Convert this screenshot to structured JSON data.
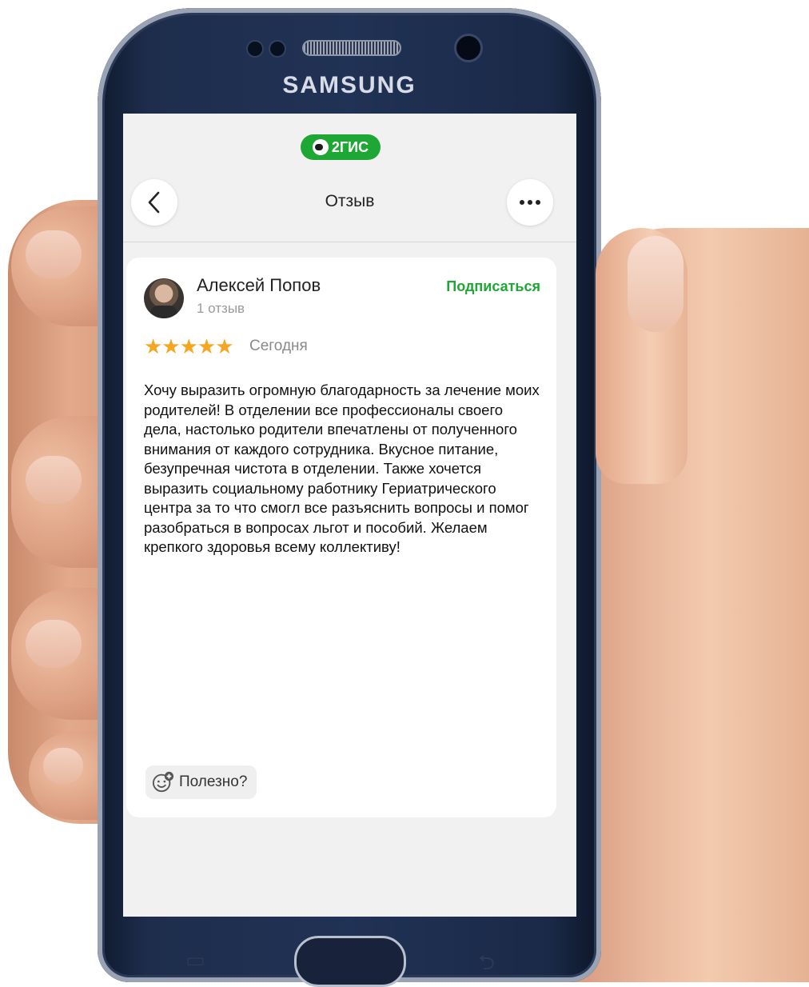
{
  "device": {
    "brand": "SAMSUNG"
  },
  "app": {
    "logo_text": "2ГИС",
    "title": "Отзыв",
    "colors": {
      "accent": "#1fa736",
      "star": "#f5a623"
    }
  },
  "review": {
    "author": "Алексей Попов",
    "author_reviews": "1 отзыв",
    "subscribe_label": "Подписаться",
    "stars": "★★★★★",
    "rating": 5,
    "date": "Сегодня",
    "text": "Хочу выразить огромную благодарность за лечение моих родителей! В отделении все профессионалы своего дела, настолько родители впечатлены от полученного внимания от каждого сотрудника. Вкусное питание, безупречная чистота в отделении. Также хочется выразить социальному работнику Гериатрического центра за то что смогл все разъяснить вопросы и помог разобраться в вопросах льгот и пособий. Желаем крепкого здоровья всему коллективу!",
    "helpful_label": "Полезно?"
  },
  "icons": {
    "back": "chevron-left-icon",
    "more": "more-dots-icon",
    "helpful": "smile-plus-icon"
  }
}
